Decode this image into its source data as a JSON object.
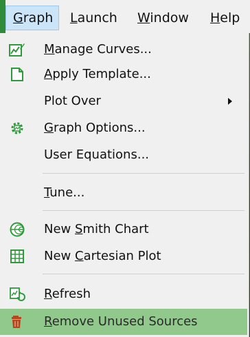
{
  "menubar": {
    "items": [
      {
        "pre": "",
        "acc": "G",
        "post": "raph"
      },
      {
        "pre": "",
        "acc": "L",
        "post": "aunch"
      },
      {
        "pre": "",
        "acc": "W",
        "post": "indow"
      },
      {
        "pre": "",
        "acc": "H",
        "post": "elp"
      }
    ]
  },
  "menu": {
    "items": [
      {
        "pre": "",
        "acc": "M",
        "post": "anage Curves...",
        "icon": "manage-curves-icon"
      },
      {
        "pre": "",
        "acc": "A",
        "post": "pply Template...",
        "icon": "apply-template-icon"
      },
      {
        "pre": "Plot Over",
        "acc": "",
        "post": "",
        "icon": ""
      },
      {
        "pre": "",
        "acc": "G",
        "post": "raph Options...",
        "icon": "graph-options-icon"
      },
      {
        "pre": "User Equations...",
        "acc": "",
        "post": "",
        "icon": ""
      },
      {
        "pre": "",
        "acc": "T",
        "post": "une...",
        "icon": ""
      },
      {
        "pre": "New ",
        "acc": "S",
        "post": "mith Chart",
        "icon": "smith-chart-icon"
      },
      {
        "pre": "New ",
        "acc": "C",
        "post": "artesian Plot",
        "icon": "cartesian-plot-icon"
      },
      {
        "pre": "",
        "acc": "R",
        "post": "efresh",
        "icon": "refresh-icon"
      },
      {
        "pre": "",
        "acc": "R",
        "post": "emove Unused Sources",
        "icon": "trash-icon"
      }
    ],
    "highlight_color": "#91c98c"
  },
  "colors": {
    "menu_bg": "#f0f0f0",
    "active_bg": "#cce4f7",
    "icon_green": "#2e9a3c",
    "trash_red": "#b5471c"
  }
}
